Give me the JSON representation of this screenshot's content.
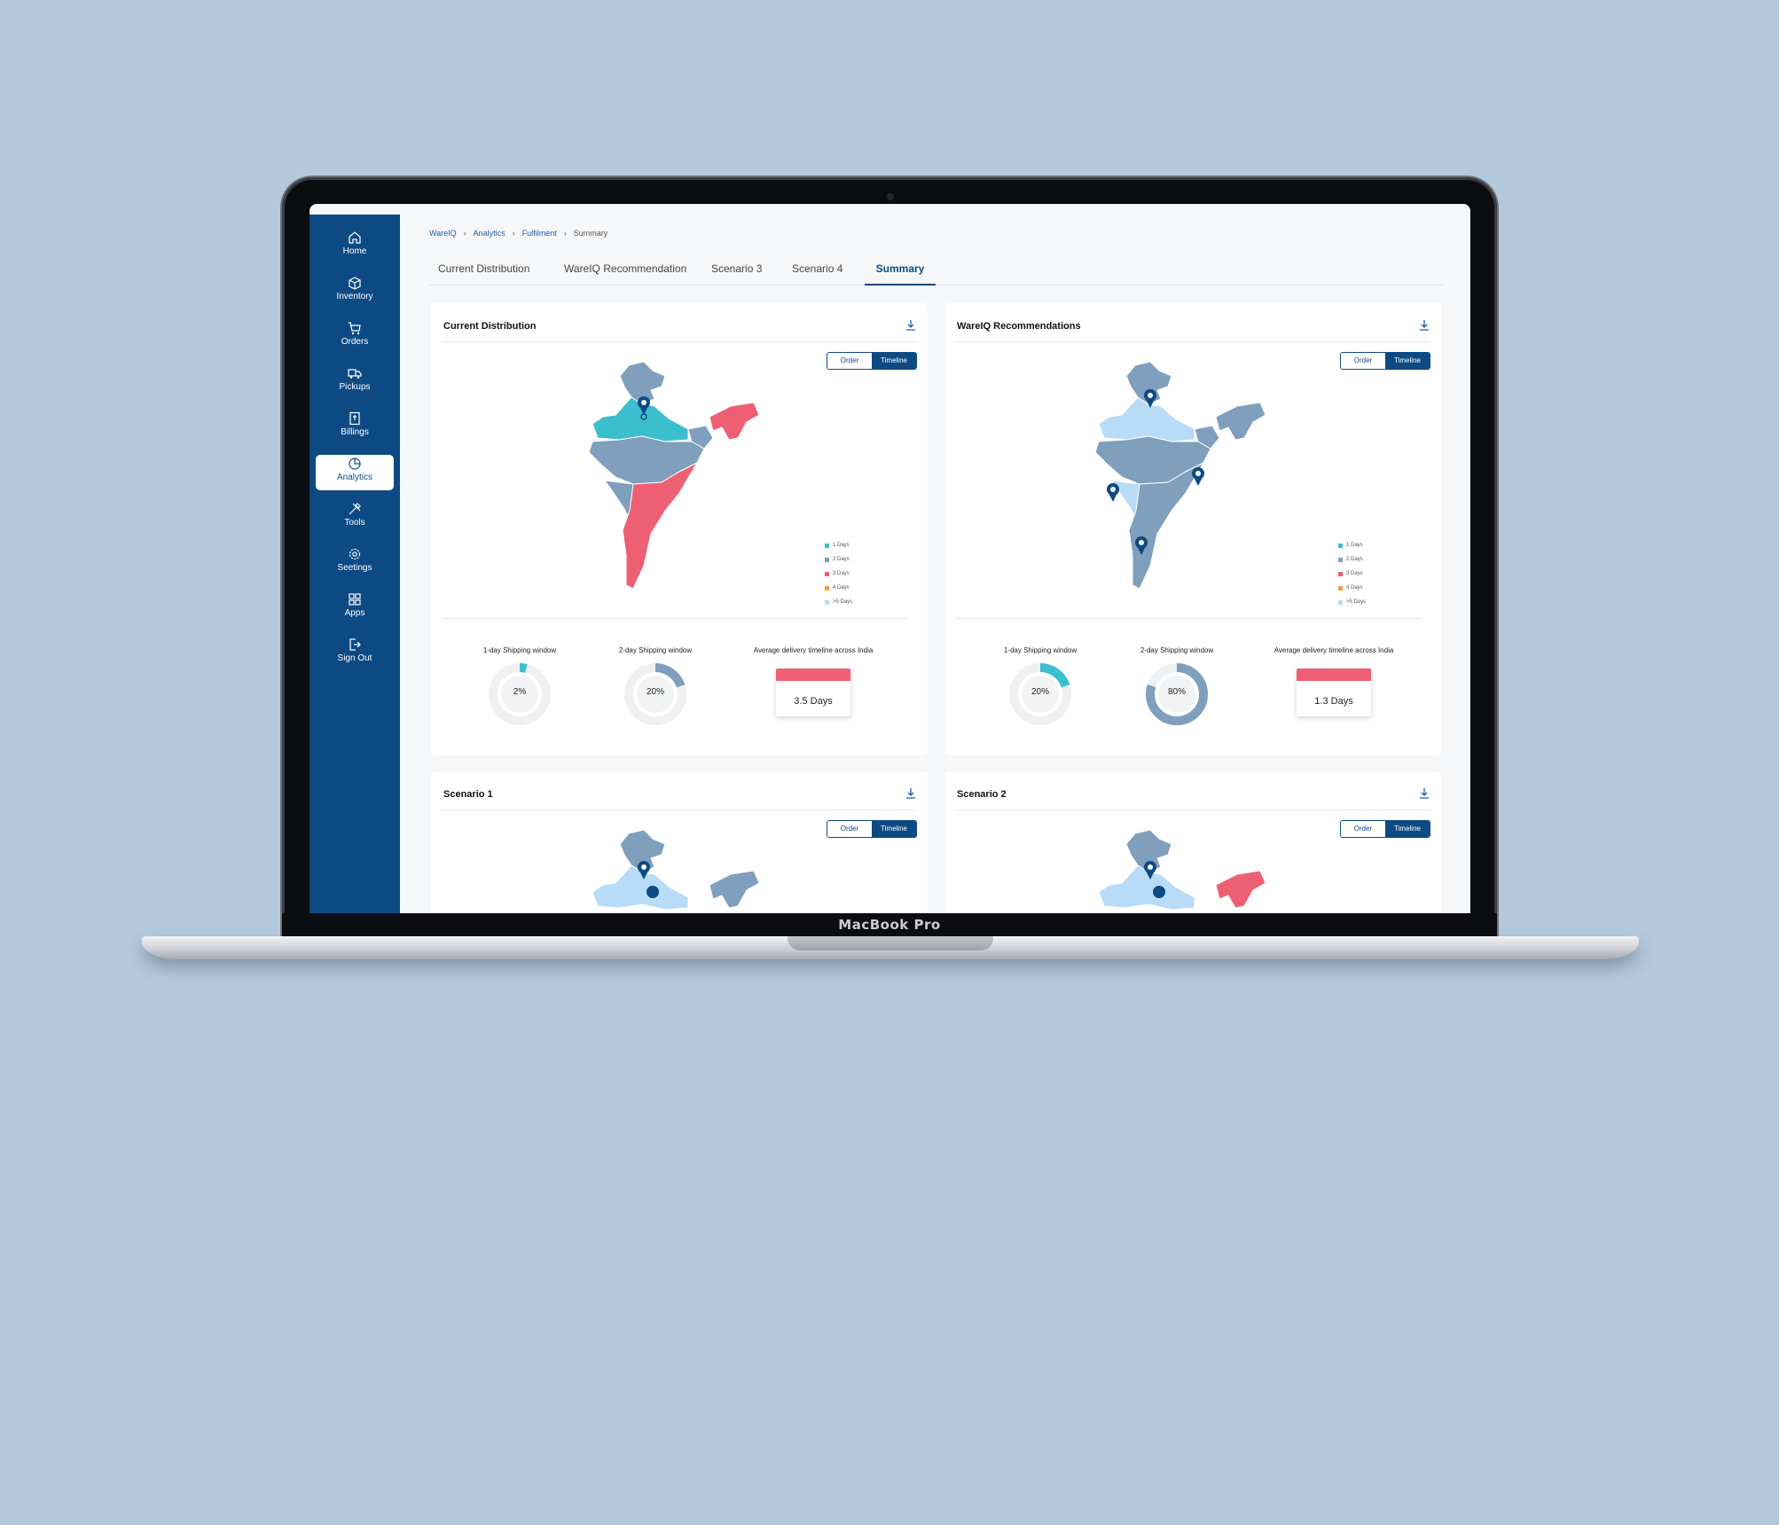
{
  "device": {
    "label": "MacBook Pro"
  },
  "sidebar": {
    "items": [
      {
        "label": "Home",
        "icon": "home-icon"
      },
      {
        "label": "Inventory",
        "icon": "box-icon"
      },
      {
        "label": "Orders",
        "icon": "cart-icon"
      },
      {
        "label": "Pickups",
        "icon": "truck-icon"
      },
      {
        "label": "Billings",
        "icon": "bill-icon"
      },
      {
        "label": "Analytics",
        "icon": "pie-chart-icon",
        "active": true
      },
      {
        "label": "Tools",
        "icon": "tools-icon"
      },
      {
        "label": "Seetings",
        "icon": "gear-icon"
      },
      {
        "label": "Apps",
        "icon": "grid-icon"
      },
      {
        "label": "Sign Out",
        "icon": "sign-out-icon"
      }
    ]
  },
  "breadcrumb": [
    "WareIQ",
    "Analytics",
    "Fulfilment",
    "Summary"
  ],
  "tabs": [
    "Current Distribution",
    "WareIQ Recommendation",
    "Scenario 3",
    "Scenario 4",
    "Summary"
  ],
  "active_tab": "Summary",
  "toggle": {
    "order": "Order",
    "timeline": "Timeline",
    "selected": "Timeline"
  },
  "legend": [
    {
      "label": "1 Days",
      "color": "#3bbfcf"
    },
    {
      "label": "2 Days",
      "color": "#7f9fbd"
    },
    {
      "label": "3 Days",
      "color": "#ee5f73"
    },
    {
      "label": "4 Days",
      "color": "#f2994a"
    },
    {
      "label": ">5 Days",
      "color": "#b8dcf7"
    }
  ],
  "colors": {
    "brand": "#0d4a84",
    "one_day": "#3bbfcf",
    "two_day": "#7f9fbd",
    "three_day": "#ee5f73",
    "four_day": "#f2994a",
    "five_plus": "#b8dcf7"
  },
  "cards": {
    "current": {
      "title": "Current Distribution",
      "one_day_label": "1-day Shipping window",
      "one_day_value": "2%",
      "one_day_fraction": 0.02,
      "two_day_label": "2-day Shipping window",
      "two_day_value": "20%",
      "two_day_fraction": 0.2,
      "avg_label": "Average delivery timeline across India",
      "avg_value": "3.5 Days"
    },
    "wareiq": {
      "title": "WareIQ Recommendations",
      "one_day_label": "1-day Shipping window",
      "one_day_value": "20%",
      "one_day_fraction": 0.2,
      "two_day_label": "2-day Shipping window",
      "two_day_value": "80%",
      "two_day_fraction": 0.8,
      "avg_label": "Average delivery timeline across India",
      "avg_value": "1.3 Days"
    },
    "scenario1": {
      "title": "Scenario 1"
    },
    "scenario2": {
      "title": "Scenario 2"
    }
  }
}
